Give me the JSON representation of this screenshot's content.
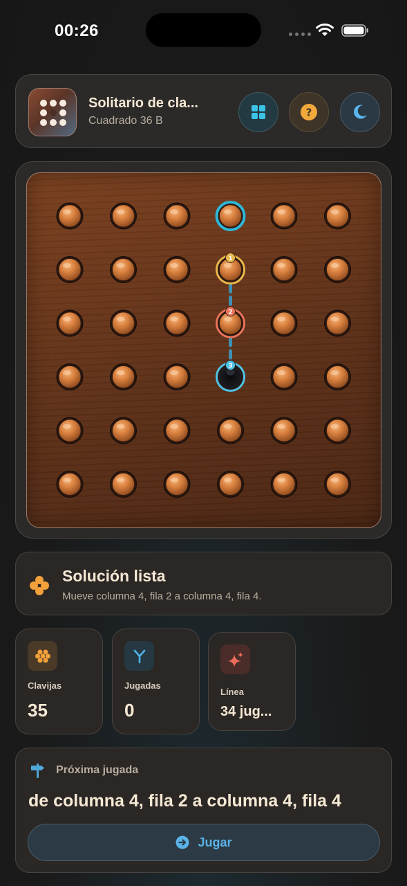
{
  "status_bar": {
    "time": "00:26"
  },
  "header": {
    "title": "Solitario de cla...",
    "subtitle": "Cuadrado 36 B",
    "buttons": [
      "grid-icon",
      "help-icon",
      "moon-icon"
    ]
  },
  "board": {
    "rows": 6,
    "cols": 6,
    "empty": [
      [
        3,
        3
      ]
    ],
    "highlight_ring": [
      0,
      3
    ],
    "path": [
      {
        "step": "1",
        "row": 1,
        "col": 3,
        "color": "#e8b64b"
      },
      {
        "step": "2",
        "row": 2,
        "col": 3,
        "color": "#e8735a"
      },
      {
        "step": "3",
        "row": 3,
        "col": 3,
        "color": "#4fc3e6"
      }
    ],
    "colors": {
      "ring_top": "#2fb7d8",
      "peg": "#d9813f"
    }
  },
  "solution": {
    "title": "Solución lista",
    "description": "Mueve columna 4, fila 2 a columna 4, fila 4."
  },
  "stats": [
    {
      "label": "Clavijas",
      "value": "35",
      "icon": "pegs-icon",
      "color": "#f2a13b"
    },
    {
      "label": "Jugadas",
      "value": "0",
      "icon": "fork-icon",
      "color": "#4fb4e6"
    },
    {
      "label": "Línea",
      "value": "34 jug...",
      "icon": "sparkle-icon",
      "color": "#ee6c5a"
    }
  ],
  "next": {
    "label": "Próxima jugada",
    "move": "de columna 4, fila 2 a columna 4, fila 4",
    "button": "Jugar"
  }
}
